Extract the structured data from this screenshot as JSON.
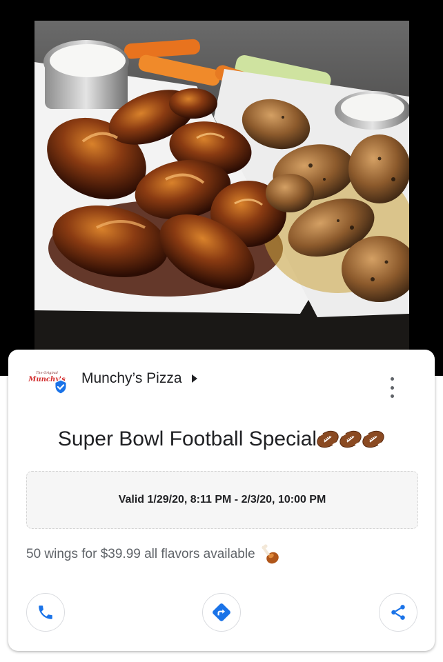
{
  "post": {
    "image_alt": "Plates of glazed and seasoned chicken wings with ranch, carrots and celery",
    "business": {
      "name": "Munchy’s Pizza",
      "logo_text": "Munchy's",
      "logo_subtext": "The Original",
      "verified": true
    },
    "title": "Super Bowl Football Special",
    "title_emoji": [
      "football-icon",
      "football-icon",
      "football-icon"
    ],
    "validity": "Valid 1/29/20, 8:11 PM - 2/3/20, 10:00 PM",
    "description": "50 wings for $39.99 all flavors available",
    "description_emoji": "poultry-leg-icon",
    "actions": [
      {
        "name": "call",
        "icon": "phone-icon"
      },
      {
        "name": "directions",
        "icon": "directions-icon"
      },
      {
        "name": "share",
        "icon": "share-icon"
      }
    ]
  },
  "colors": {
    "accent_blue": "#1a73e8",
    "logo_red": "#d32f2f",
    "title_text": "#202124",
    "secondary_text": "#5f6368"
  }
}
